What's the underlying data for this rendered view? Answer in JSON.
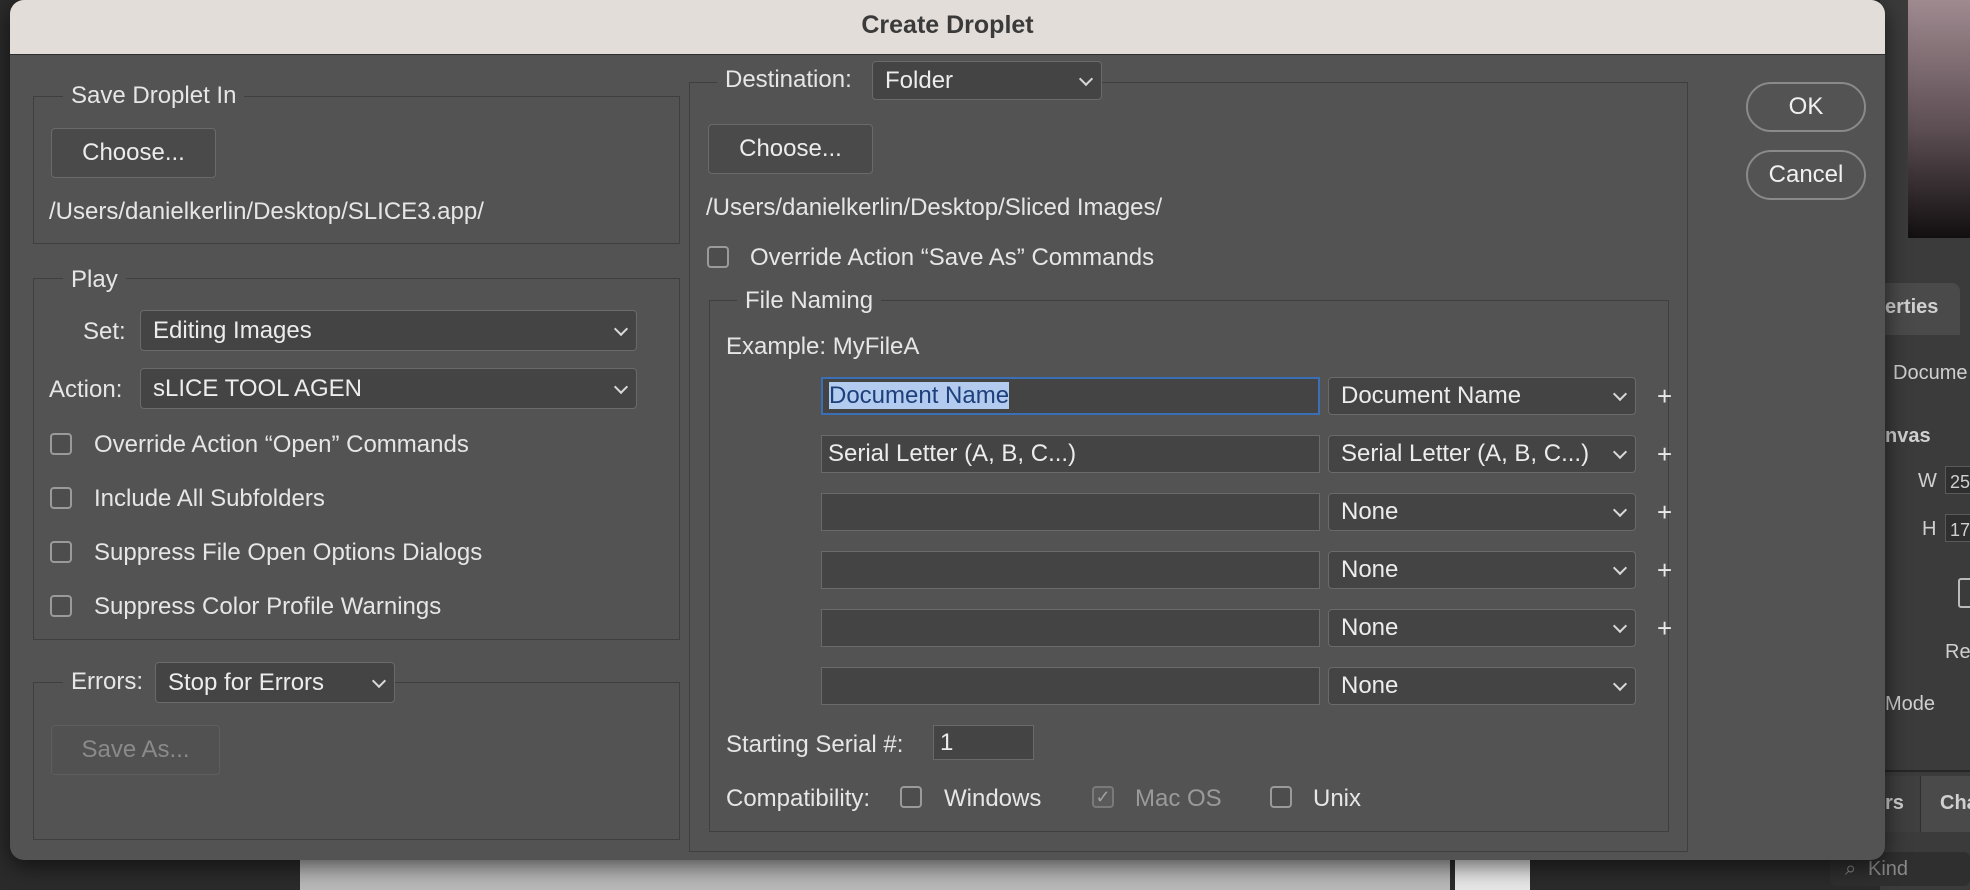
{
  "dialog": {
    "title": "Create Droplet"
  },
  "save_in": {
    "legend": "Save Droplet In",
    "choose_label": "Choose...",
    "path": "/Users/danielkerlin/Desktop/SLICE3.app/"
  },
  "play": {
    "legend": "Play",
    "set_label": "Set:",
    "set_value": "Editing Images",
    "action_label": "Action:",
    "action_value": "sLICE TOOL AGEN",
    "options": [
      {
        "label": "Override Action “Open” Commands",
        "checked": false
      },
      {
        "label": "Include All Subfolders",
        "checked": false
      },
      {
        "label": "Suppress File Open Options Dialogs",
        "checked": false
      },
      {
        "label": "Suppress Color Profile Warnings",
        "checked": false
      }
    ]
  },
  "errors": {
    "label": "Errors:",
    "value": "Stop for Errors",
    "save_as_label": "Save As..."
  },
  "destination": {
    "label": "Destination:",
    "value": "Folder",
    "choose_label": "Choose...",
    "path": "/Users/danielkerlin/Desktop/Sliced Images/",
    "override_label": "Override Action “Save As” Commands"
  },
  "file_naming": {
    "legend": "File Naming",
    "example": "Example: MyFileA",
    "rows": [
      {
        "text": "Document Name",
        "select": "Document Name"
      },
      {
        "text": "Serial Letter (A, B, C...)",
        "select": "Serial Letter (A, B, C...)"
      },
      {
        "text": "",
        "select": "None"
      },
      {
        "text": "",
        "select": "None"
      },
      {
        "text": "",
        "select": "None"
      },
      {
        "text": "",
        "select": "None"
      }
    ],
    "plus_symbol": "+",
    "serial_label": "Starting Serial #:",
    "serial_value": "1",
    "compat_label": "Compatibility:",
    "compat": [
      {
        "label": "Windows",
        "checked": false,
        "enabled": true
      },
      {
        "label": "Mac OS",
        "checked": true,
        "enabled": false
      },
      {
        "label": "Unix",
        "checked": false,
        "enabled": true
      }
    ]
  },
  "buttons": {
    "ok": "OK",
    "cancel": "Cancel"
  },
  "background_panel": {
    "tab_label": "erties",
    "document_label": "Docume",
    "canvas_label": "nvas",
    "w_label": "W",
    "w_value": "25",
    "h_label": "H",
    "h_value": "17",
    "re_label": "Re",
    "mode_label": "Mode",
    "layers_tab": "rs",
    "channels_tab": "Cha",
    "kind_placeholder": "Kind"
  }
}
